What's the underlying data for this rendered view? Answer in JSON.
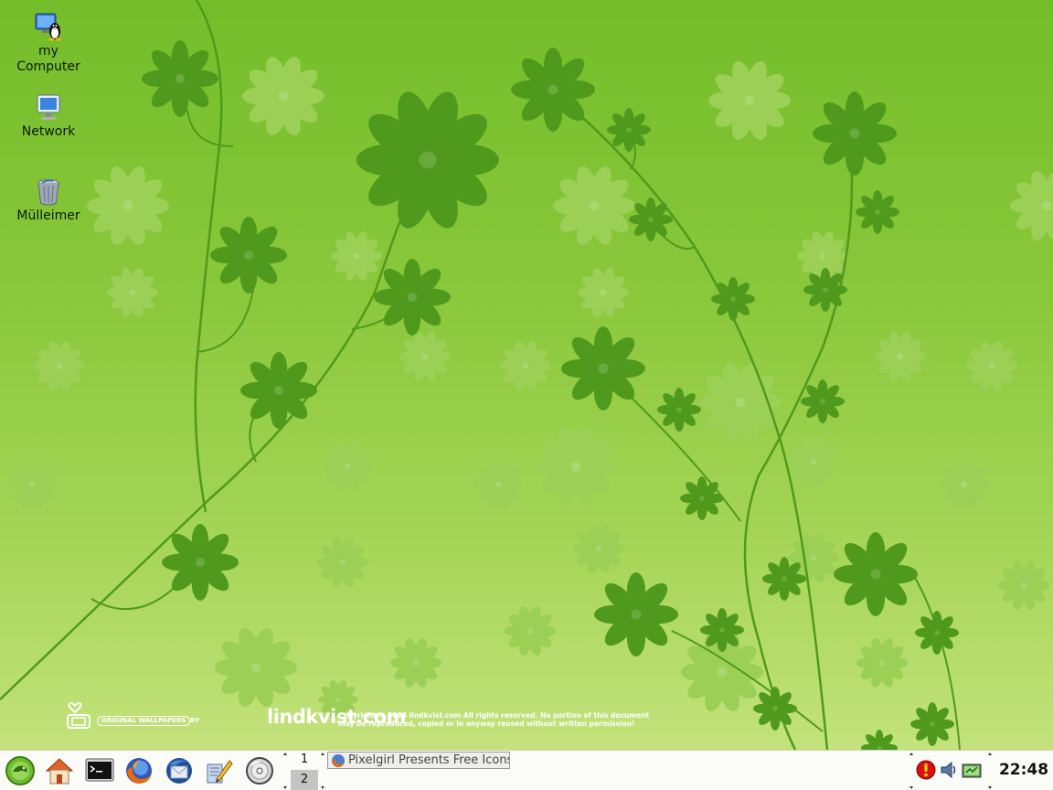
{
  "desktop": {
    "icons": [
      {
        "label_line1": "my",
        "label_line2": "Computer",
        "icon": "computer-tux-icon"
      },
      {
        "label": "Network",
        "icon": "network-monitor-icon"
      },
      {
        "label": "Mülleimer",
        "icon": "trash-can-icon"
      }
    ],
    "wallpaper": {
      "badge": "ORIGINAL WALLPAPERS",
      "by": "BY",
      "logo_text": "lindkvist.com",
      "copyright_line1": "Copyright © 2004 lindkvist.com All rights reserved. No portion of this document",
      "copyright_line2": "may be reproduced, copied or in anyway reused without written permission!"
    }
  },
  "taskbar": {
    "launchers": [
      {
        "name": "suse-menu",
        "icon": "suse-gecko-icon"
      },
      {
        "name": "home",
        "icon": "home-icon"
      },
      {
        "name": "terminal",
        "icon": "terminal-icon"
      },
      {
        "name": "firefox",
        "icon": "firefox-icon"
      },
      {
        "name": "thunderbird",
        "icon": "thunderbird-icon"
      },
      {
        "name": "office",
        "icon": "pen-brush-icon"
      },
      {
        "name": "cd-player",
        "icon": "cd-icon"
      }
    ],
    "pager": [
      "1",
      "2"
    ],
    "active_desktop": "2",
    "task": {
      "title": "Pixelgirl Presents Free Icons"
    },
    "tray": [
      "alert-icon",
      "volume-icon",
      "network-status-icon"
    ],
    "clock": "22:48"
  },
  "colors": {
    "wallpaper_top": "#74bd2a",
    "wallpaper_bottom": "#c3e27c",
    "flower_dark": "#4f9a1c",
    "flower_faint": "#9ccf56",
    "taskbar_bg": "#fbfbf7"
  }
}
